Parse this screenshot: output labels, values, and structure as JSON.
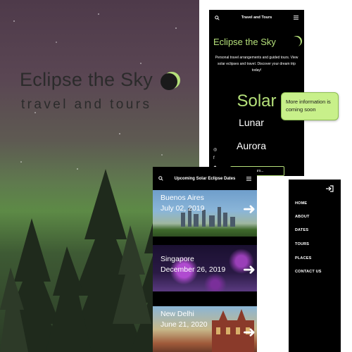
{
  "hero": {
    "title": "Eclipse the Sky",
    "subtitle": "travel and tours"
  },
  "phone1": {
    "header_title": "Travel and Tours",
    "brand": "Eclipse the Sky",
    "description": "Personal travel arrangements and guided tours. View solar eclipses and travel. Discover your dream trip today!",
    "categories": [
      "Solar",
      "Lunar",
      "Aurora"
    ],
    "search_placeholder": "Search tours..."
  },
  "tooltip": {
    "text": "More information is coming soon"
  },
  "phone2": {
    "header_title": "Upcoming Solar Eclipse Dates",
    "cards": [
      {
        "city": "Buenos Aires",
        "date": "July 02, 2019"
      },
      {
        "city": "Singapore",
        "date": "December 26, 2019"
      },
      {
        "city": "New Delhi",
        "date": "June 21, 2020"
      }
    ]
  },
  "menu": {
    "items": [
      "HOME",
      "ABOUT",
      "DATES",
      "TOURS",
      "PLACES",
      "CONTACT US"
    ]
  },
  "colors": {
    "accent": "#b5e07a",
    "tooltip_bg": "#c8f08a",
    "panel_bg": "#000000"
  }
}
